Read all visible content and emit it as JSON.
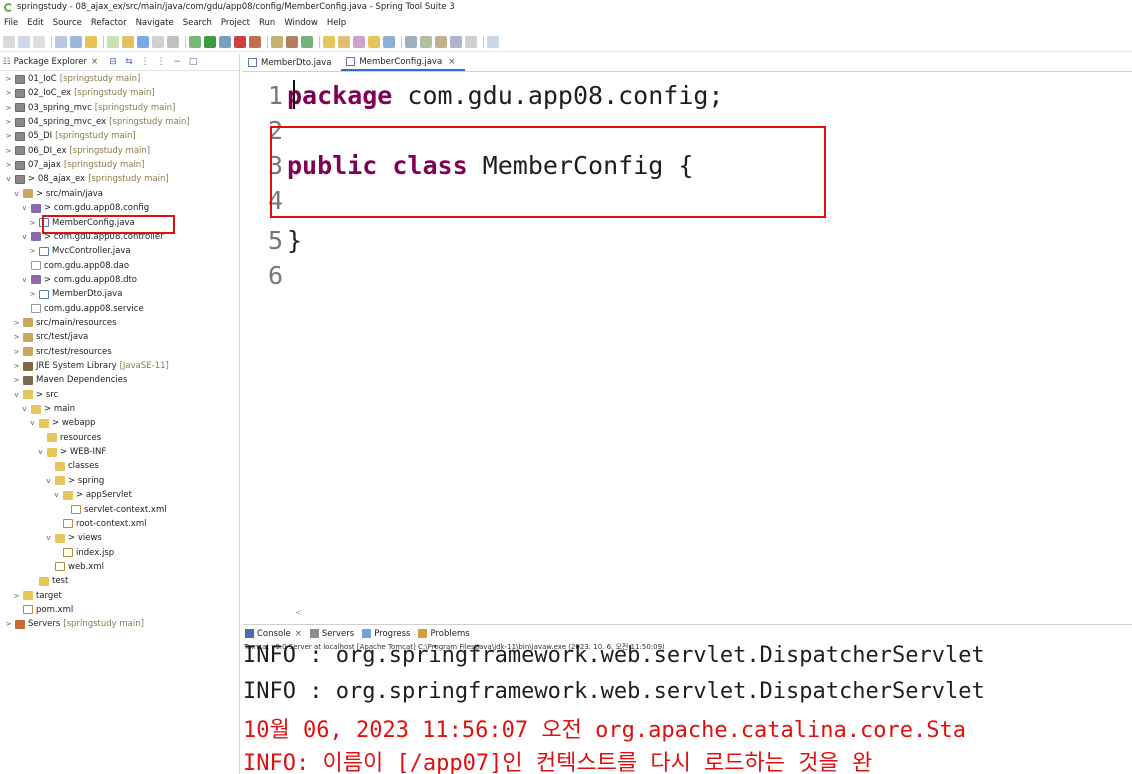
{
  "window": {
    "title": "springstudy - 08_ajax_ex/src/main/java/com/gdu/app08/config/MemberConfig.java - Spring Tool Suite 3"
  },
  "menubar": [
    "File",
    "Edit",
    "Source",
    "Refactor",
    "Navigate",
    "Search",
    "Project",
    "Run",
    "Window",
    "Help"
  ],
  "explorer": {
    "title": "Package Explorer",
    "close": "×",
    "tree": [
      {
        "label": "01_IoC",
        "suffix": "[springstudy main]",
        "icon": "project-icon",
        "twisty": ">"
      },
      {
        "label": "02_IoC_ex",
        "suffix": "[springstudy main]",
        "icon": "project-icon",
        "twisty": ">"
      },
      {
        "label": "03_spring_mvc",
        "suffix": "[springstudy main]",
        "icon": "project-icon",
        "twisty": ">"
      },
      {
        "label": "04_spring_mvc_ex",
        "suffix": "[springstudy main]",
        "icon": "project-icon",
        "twisty": ">"
      },
      {
        "label": "05_DI",
        "suffix": "[springstudy main]",
        "icon": "project-icon",
        "twisty": ">"
      },
      {
        "label": "06_DI_ex",
        "suffix": "[springstudy main]",
        "icon": "project-icon",
        "twisty": ">"
      },
      {
        "label": "07_ajax",
        "suffix": "[springstudy main]",
        "icon": "project-icon",
        "twisty": ">"
      },
      {
        "label": "> 08_ajax_ex",
        "suffix": "[springstudy main]",
        "icon": "project-icon",
        "twisty": "v"
      },
      {
        "label": "> src/main/java",
        "suffix": "",
        "icon": "source-folder-icon",
        "twisty": "v"
      },
      {
        "label": "> com.gdu.app08.config",
        "suffix": "",
        "icon": "package-icon",
        "twisty": "v"
      },
      {
        "label": "MemberConfig.java",
        "suffix": "",
        "icon": "java-file-icon",
        "twisty": ">"
      },
      {
        "label": "> com.gdu.app08.controller",
        "suffix": "",
        "icon": "package-icon",
        "twisty": "v"
      },
      {
        "label": "MvcController.java",
        "suffix": "",
        "icon": "java-file-icon",
        "twisty": ">"
      },
      {
        "label": "com.gdu.app08.dao",
        "suffix": "",
        "icon": "empty-package-icon",
        "twisty": ""
      },
      {
        "label": "> com.gdu.app08.dto",
        "suffix": "",
        "icon": "package-icon",
        "twisty": "v"
      },
      {
        "label": "MemberDto.java",
        "suffix": "",
        "icon": "java-file-icon",
        "twisty": ">"
      },
      {
        "label": "com.gdu.app08.service",
        "suffix": "",
        "icon": "empty-package-icon",
        "twisty": ""
      },
      {
        "label": "src/main/resources",
        "suffix": "",
        "icon": "source-folder-icon",
        "twisty": ">"
      },
      {
        "label": "src/test/java",
        "suffix": "",
        "icon": "source-folder-icon",
        "twisty": ">"
      },
      {
        "label": "src/test/resources",
        "suffix": "",
        "icon": "source-folder-icon",
        "twisty": ">"
      },
      {
        "label": "JRE System Library",
        "suffix": "[JavaSE-11]",
        "icon": "library-icon",
        "twisty": ">"
      },
      {
        "label": "Maven Dependencies",
        "suffix": "",
        "icon": "library-icon",
        "twisty": ">"
      },
      {
        "label": "> src",
        "suffix": "",
        "icon": "folder-icon",
        "twisty": "v"
      },
      {
        "label": "> main",
        "suffix": "",
        "icon": "folder-icon",
        "twisty": "v"
      },
      {
        "label": "> webapp",
        "suffix": "",
        "icon": "folder-icon",
        "twisty": "v"
      },
      {
        "label": "resources",
        "suffix": "",
        "icon": "folder-icon",
        "twisty": ""
      },
      {
        "label": "> WEB-INF",
        "suffix": "",
        "icon": "folder-icon",
        "twisty": "v"
      },
      {
        "label": "classes",
        "suffix": "",
        "icon": "folder-icon",
        "twisty": ""
      },
      {
        "label": "> spring",
        "suffix": "",
        "icon": "folder-icon",
        "twisty": "v"
      },
      {
        "label": "> appServlet",
        "suffix": "",
        "icon": "folder-icon",
        "twisty": "v"
      },
      {
        "label": "servlet-context.xml",
        "suffix": "",
        "icon": "xml-file-icon",
        "twisty": ""
      },
      {
        "label": "root-context.xml",
        "suffix": "",
        "icon": "xml-file-icon",
        "twisty": ""
      },
      {
        "label": "> views",
        "suffix": "",
        "icon": "folder-icon",
        "twisty": "v"
      },
      {
        "label": "index.jsp",
        "suffix": "",
        "icon": "xml-file-icon",
        "twisty": ""
      },
      {
        "label": "web.xml",
        "suffix": "",
        "icon": "xml-file-icon",
        "twisty": ""
      },
      {
        "label": "test",
        "suffix": "",
        "icon": "folder-icon",
        "twisty": ""
      },
      {
        "label": "target",
        "suffix": "",
        "icon": "folder-icon",
        "twisty": ">"
      },
      {
        "label": "pom.xml",
        "suffix": "",
        "icon": "xml-file-icon",
        "twisty": ""
      },
      {
        "label": "Servers",
        "suffix": "[springstudy main]",
        "icon": "server-icon",
        "twisty": ">"
      }
    ]
  },
  "editor": {
    "tabs": [
      {
        "label": "MemberDto.java",
        "active": false
      },
      {
        "label": "MemberConfig.java",
        "active": true,
        "close": "×"
      }
    ],
    "lines": [
      {
        "num": "1",
        "keyword": "package",
        "text": " com.gdu.app08.config;"
      },
      {
        "num": "2",
        "keyword": "",
        "text": ""
      },
      {
        "num": "3",
        "keyword": "public class",
        "text": " MemberConfig {"
      },
      {
        "num": "4",
        "keyword": "",
        "text": ""
      },
      {
        "num": "5",
        "keyword": "",
        "text": "}"
      },
      {
        "num": "6",
        "keyword": "",
        "text": ""
      }
    ],
    "scroll_arrow": "<"
  },
  "console": {
    "tabs": [
      {
        "label": "Console",
        "close": "×",
        "icon": "console-icon"
      },
      {
        "label": "Servers",
        "icon": "servers-icon"
      },
      {
        "label": "Progress",
        "icon": "progress-icon"
      },
      {
        "label": "Problems",
        "icon": "problems-icon"
      }
    ],
    "description": "Tomcat v9.0 Server at localhost [Apache Tomcat] C:\\Program Files\\Java\\jdk-11\\bin\\javaw.exe  (2023. 10. 6. 오전 11:50:09)",
    "lines": [
      {
        "text": "INFO : org.springframework.web.servlet.DispatcherServlet",
        "color": "#1e1e1e"
      },
      {
        "text": "INFO : org.springframework.web.servlet.DispatcherServlet",
        "color": "#1e1e1e"
      },
      {
        "text": "10월 06, 2023 11:56:07 오전 org.apache.catalina.core.Sta",
        "color": "#e01010"
      },
      {
        "text": "INFO: 이름이 [/app07]인 컨텍스트를 다시 로드하는 것을 완",
        "color": "#e01010"
      }
    ]
  },
  "colors": {
    "keyword": "#7f0055",
    "highlight_box": "#e01010",
    "accent": "#2f6fd0"
  }
}
